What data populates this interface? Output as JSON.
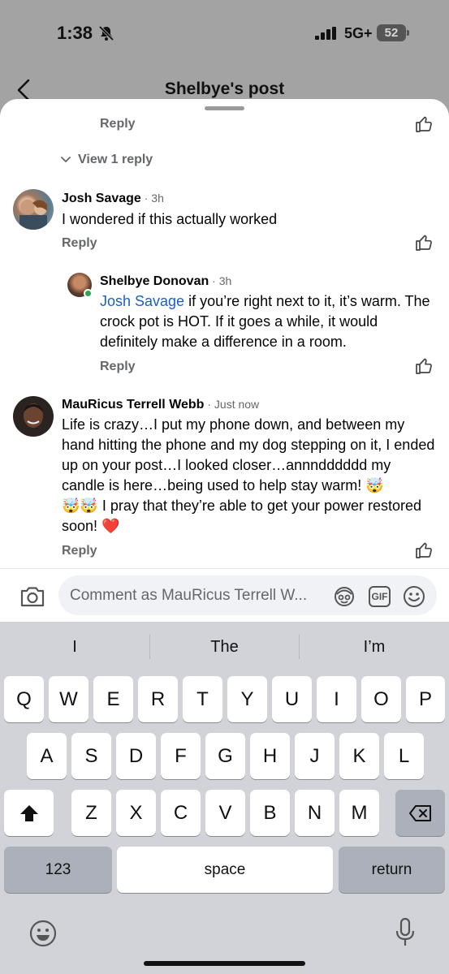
{
  "status_bar": {
    "time": "1:38",
    "network": "5G+",
    "battery": "52"
  },
  "header": {
    "title": "Shelbye's post"
  },
  "thread": {
    "top_reply_label": "Reply",
    "view_replies_label": "View 1 reply",
    "comments": [
      {
        "author": "Josh Savage",
        "time": "3h",
        "text": "I wondered if this actually worked",
        "reply_label": "Reply"
      },
      {
        "author": "Shelbye Donovan",
        "time": "3h",
        "mention": "Josh Savage",
        "text": " if you’re right next to it, it’s warm. The crock pot is HOT. If it goes a while, it would definitely make a difference in a room.",
        "reply_label": "Reply"
      },
      {
        "author": "MauRicus Terrell Webb",
        "time": "Just now",
        "text_part1": "Life is crazy…I put my phone down, and between my hand hitting the phone and my dog stepping on it, I ended up on your post…I looked closer…annndddddd my candle is here…being used to help stay warm! ",
        "emoji1": "🤯",
        "emoji2": "🤯🤯",
        "text_part2": " I pray that they’re able to get your power restored soon! ",
        "heart": "❤️",
        "reply_label": "Reply"
      }
    ]
  },
  "composer": {
    "placeholder": "Comment as MauRicus Terrell W...",
    "gif_label": "GIF"
  },
  "keyboard": {
    "suggestions": [
      "I",
      "The",
      "I’m"
    ],
    "row1": [
      "Q",
      "W",
      "E",
      "R",
      "T",
      "Y",
      "U",
      "I",
      "O",
      "P"
    ],
    "row2": [
      "A",
      "S",
      "D",
      "F",
      "G",
      "H",
      "J",
      "K",
      "L"
    ],
    "row3": [
      "Z",
      "X",
      "C",
      "V",
      "B",
      "N",
      "M"
    ],
    "numbers_label": "123",
    "space_label": "space",
    "return_label": "return"
  },
  "colors": {
    "mention": "#1a5fc7",
    "online": "#31a24c",
    "muted": "#65676b"
  }
}
